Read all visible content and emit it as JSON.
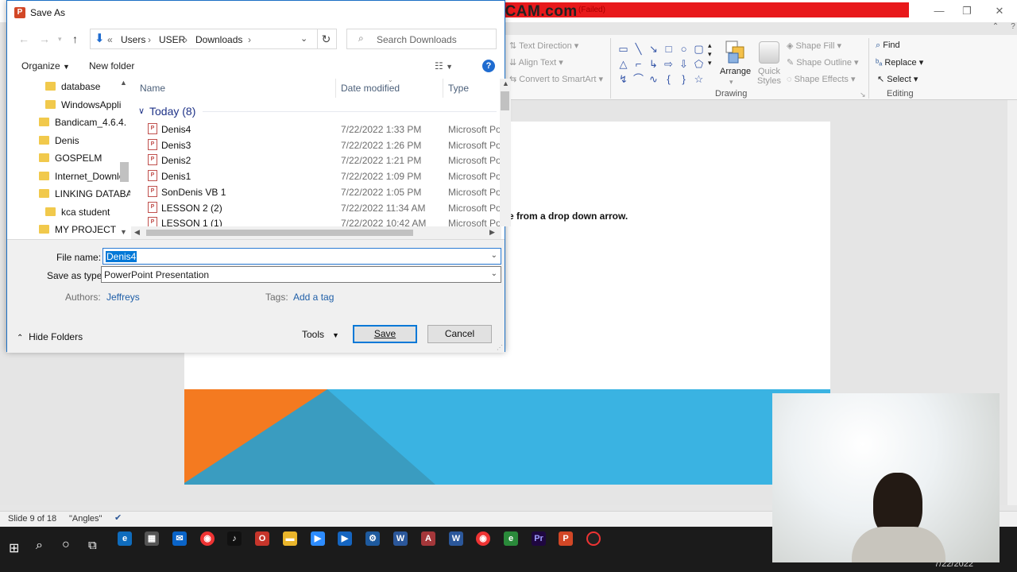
{
  "dialog": {
    "title": "Save As",
    "app_icon": "powerpoint-icon",
    "breadcrumb": [
      "Users",
      "USER",
      "Downloads"
    ],
    "breadcrumb_overflow": "«",
    "search_placeholder": "Search Downloads",
    "toolbar": {
      "organize": "Organize",
      "new_folder": "New folder"
    },
    "nav_items": [
      "database",
      "WindowsAppli",
      "Bandicam_4.6.4.",
      "Denis",
      "GOSPELM",
      "Internet_Downlo",
      "LINKING DATABA",
      "kca student",
      "MY PROJECT"
    ],
    "columns": {
      "name": "Name",
      "date": "Date modified",
      "type": "Type"
    },
    "group": "Today (8)",
    "files": [
      {
        "name": "Denis4",
        "date": "7/22/2022 1:33 PM",
        "type": "Microsoft Po"
      },
      {
        "name": "Denis3",
        "date": "7/22/2022 1:26 PM",
        "type": "Microsoft Po"
      },
      {
        "name": "Denis2",
        "date": "7/22/2022 1:21 PM",
        "type": "Microsoft Po"
      },
      {
        "name": "Denis1",
        "date": "7/22/2022 1:09 PM",
        "type": "Microsoft Po"
      },
      {
        "name": "SonDenis VB 1",
        "date": "7/22/2022 1:05 PM",
        "type": "Microsoft Po"
      },
      {
        "name": "LESSON 2 (2)",
        "date": "7/22/2022 11:34 AM",
        "type": "Microsoft Po"
      },
      {
        "name": "LESSON 1 (1)",
        "date": "7/22/2022 10:42 AM",
        "type": "Microsoft Po"
      }
    ],
    "file_name_label": "File name:",
    "file_name_value": "Denis4",
    "save_type_label": "Save as type:",
    "save_type_value": "PowerPoint Presentation",
    "authors_label": "Authors:",
    "authors_value": "Jeffreys",
    "tags_label": "Tags:",
    "tags_value": "Add a tag",
    "hide_folders": "Hide Folders",
    "tools": "Tools",
    "save": "Save",
    "cancel": "Cancel"
  },
  "recorder": {
    "watermark": "www.BANDICAM.com",
    "bar_text": "(Failed)"
  },
  "ribbon": {
    "text_direction": "Text Direction",
    "align_text": "Align Text",
    "convert_smartart": "Convert to SmartArt",
    "arrange": "Arrange",
    "quick_styles": "Quick Styles",
    "shape_fill": "Shape Fill",
    "shape_outline": "Shape Outline",
    "shape_effects": "Shape Effects",
    "find": "Find",
    "replace": "Replace",
    "select": "Select",
    "drawing_label": "Drawing",
    "editing_label": "Editing"
  },
  "slide": {
    "text": "e from a drop down arrow.",
    "accent_orange": "#f47a20",
    "accent_teal": "#3a9cc0",
    "accent_blue": "#3ab3e2"
  },
  "status": {
    "slide": "Slide 9 of 18",
    "theme": "\"Angles\""
  },
  "taskbar": {
    "clock_date": "7/22/2022"
  }
}
